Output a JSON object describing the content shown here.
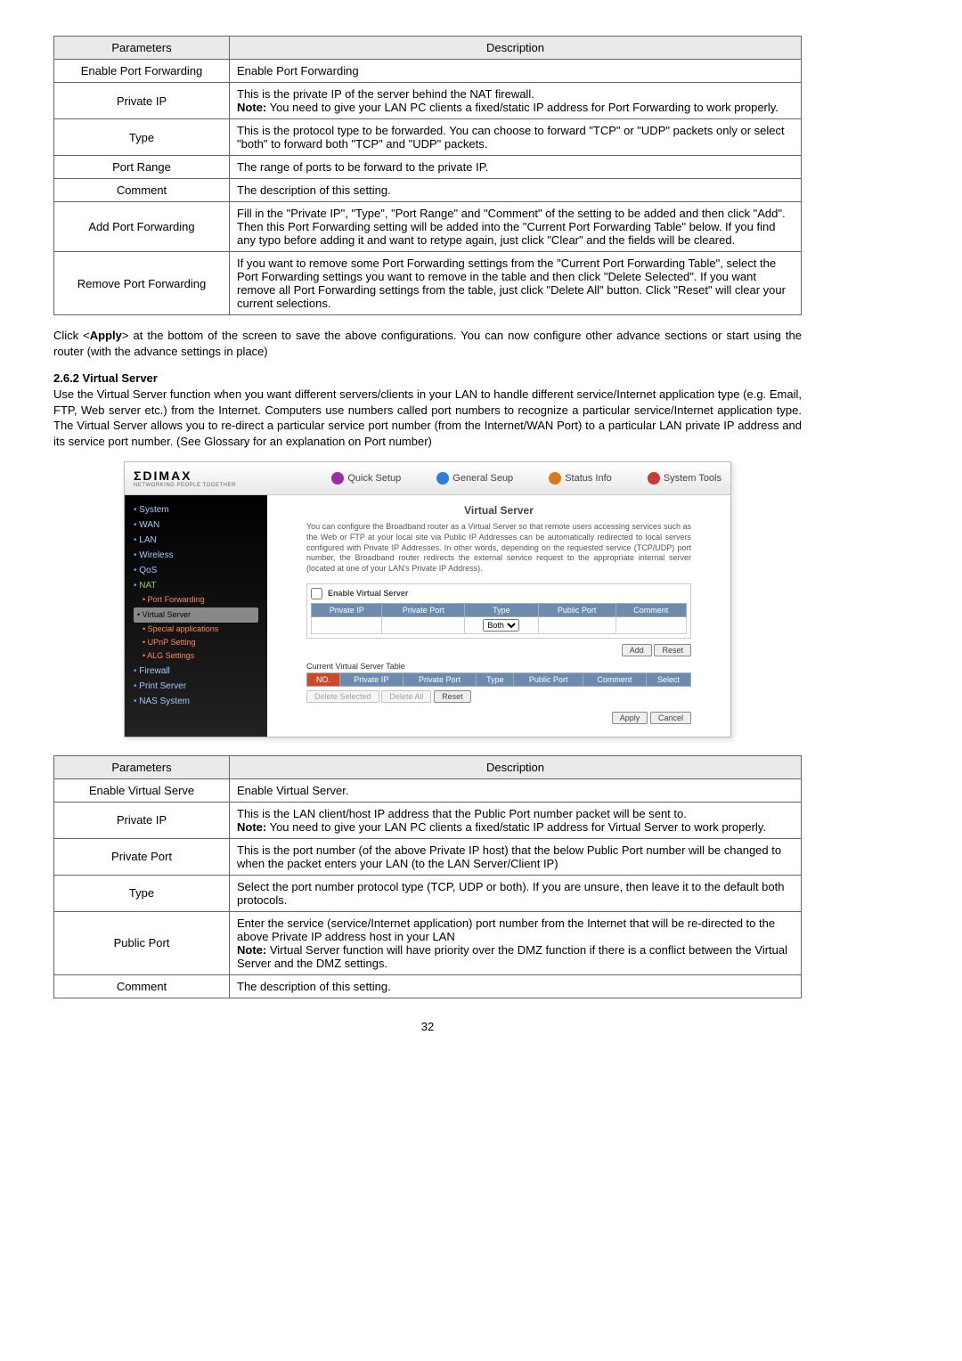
{
  "table1": {
    "header_param": "Parameters",
    "header_desc": "Description",
    "rows": [
      {
        "param": "Enable Port Forwarding",
        "desc": "Enable Port Forwarding"
      },
      {
        "param": "Private IP",
        "desc": "This is the private IP of the server behind the NAT firewall.\nNote: You need to give your LAN PC clients a fixed/static IP address for Port Forwarding to work properly."
      },
      {
        "param": "Type",
        "desc": "This is the protocol type to be forwarded. You can choose to forward \"TCP\" or \"UDP\" packets only or select \"both\" to forward both \"TCP\" and \"UDP\" packets."
      },
      {
        "param": "Port Range",
        "desc": "The range of ports to be forward to the private IP."
      },
      {
        "param": "Comment",
        "desc": "The description of this setting."
      },
      {
        "param": "Add Port Forwarding",
        "desc": "Fill in the \"Private IP\", \"Type\", \"Port Range\" and          \"Comment\" of the setting to be added and then click \"Add\". Then this Port Forwarding setting will be added into the \"Current Port Forwarding Table\" below. If you find any typo before adding it and want to retype again, just click \"Clear\" and the fields will be cleared."
      },
      {
        "param": "Remove Port Forwarding",
        "desc": "If you want to remove some Port Forwarding settings from the \"Current Port Forwarding Table\", select the Port Forwarding settings you want to remove in the table and then click \"Delete Selected\". If you want remove all Port Forwarding settings from the table, just click \"Delete All\" button. Click \"Reset\" will clear your current selections."
      }
    ]
  },
  "apply_text": "Click <Apply> at the bottom of the screen to save the above configurations. You can now configure other advance sections or start using the router (with the advance settings in place)",
  "section_num": "2.6.2 Virtual Server",
  "section_body": "Use the Virtual Server function when you want different servers/clients in your LAN to handle different service/Internet application type (e.g. Email, FTP, Web server etc.) from the Internet. Computers use numbers called port numbers to recognize a particular service/Internet application type. The Virtual Server allows you to re-direct a particular service port number (from the Internet/WAN Port) to a particular LAN private IP address and its service port number. (See Glossary for an explanation on Port number)",
  "screenshot": {
    "logo": "ΣDIMAX",
    "logo_sub": "NETWORKING PEOPLE TOGETHER",
    "tabs": [
      "Quick Setup",
      "General Seup",
      "Status Info",
      "System Tools"
    ],
    "sidebar": {
      "main": [
        "System",
        "WAN",
        "LAN",
        "Wireless",
        "QoS",
        "NAT"
      ],
      "sub": [
        "Port Forwarding",
        "Virtual Server",
        "Special applications",
        "UPnP Setting",
        "ALG Settings"
      ],
      "sub_selected_index": 1,
      "tail": [
        "Firewall",
        "Print Server",
        "NAS System"
      ]
    },
    "panel": {
      "title": "Virtual Server",
      "desc": "You can configure the Broadband router as a Virtual Server so that remote users accessing services such as the Web or FTP at your local site via Public IP Addresses can be automatically redirected to local servers configured with Private IP Addresses. In other words, depending on the requested service (TCP/UDP) port number, the Broadband router redirects the external service request to the appropriate internal server (located at one of your LAN's Private IP Address).",
      "enable_label": "Enable Virtual Server",
      "cols_new": [
        "Private IP",
        "Private Port",
        "Type",
        "Public Port",
        "Comment"
      ],
      "type_default": "Both",
      "btn_add": "Add",
      "btn_reset": "Reset",
      "current_title": "Current Virtual Server Table",
      "cols_cur": [
        "NO.",
        "Private IP",
        "Private Port",
        "Type",
        "Public Port",
        "Comment",
        "Select"
      ],
      "btn_del_sel": "Delete Selected",
      "btn_del_all": "Delete All",
      "btn_reset2": "Reset",
      "btn_apply": "Apply",
      "btn_cancel": "Cancel"
    }
  },
  "table2": {
    "header_param": "Parameters",
    "header_desc": "Description",
    "rows": [
      {
        "param": "Enable Virtual Serve",
        "desc": "Enable Virtual Server."
      },
      {
        "param": "Private IP",
        "desc": "This is the LAN client/host IP address that the Public Port number packet will be sent to.\nNote: You need to give your LAN PC clients a fixed/static IP address for Virtual Server to work properly."
      },
      {
        "param": "Private Port",
        "desc": "This is the port number (of the above Private IP host) that the below Public Port number will be changed to when the packet enters your LAN (to the LAN Server/Client IP)"
      },
      {
        "param": "Type",
        "desc": "Select the port number protocol type (TCP, UDP or both). If you are unsure, then leave it to the default both protocols."
      },
      {
        "param": "Public Port",
        "desc": "Enter the service (service/Internet application) port number from the Internet that will be re-directed to the above Private IP address host in your LAN\nNote: Virtual Server function will have priority over the DMZ function if there is a conflict between the Virtual Server and the DMZ settings."
      },
      {
        "param": "Comment",
        "desc": "The description of this setting."
      }
    ]
  },
  "page_number": "32"
}
